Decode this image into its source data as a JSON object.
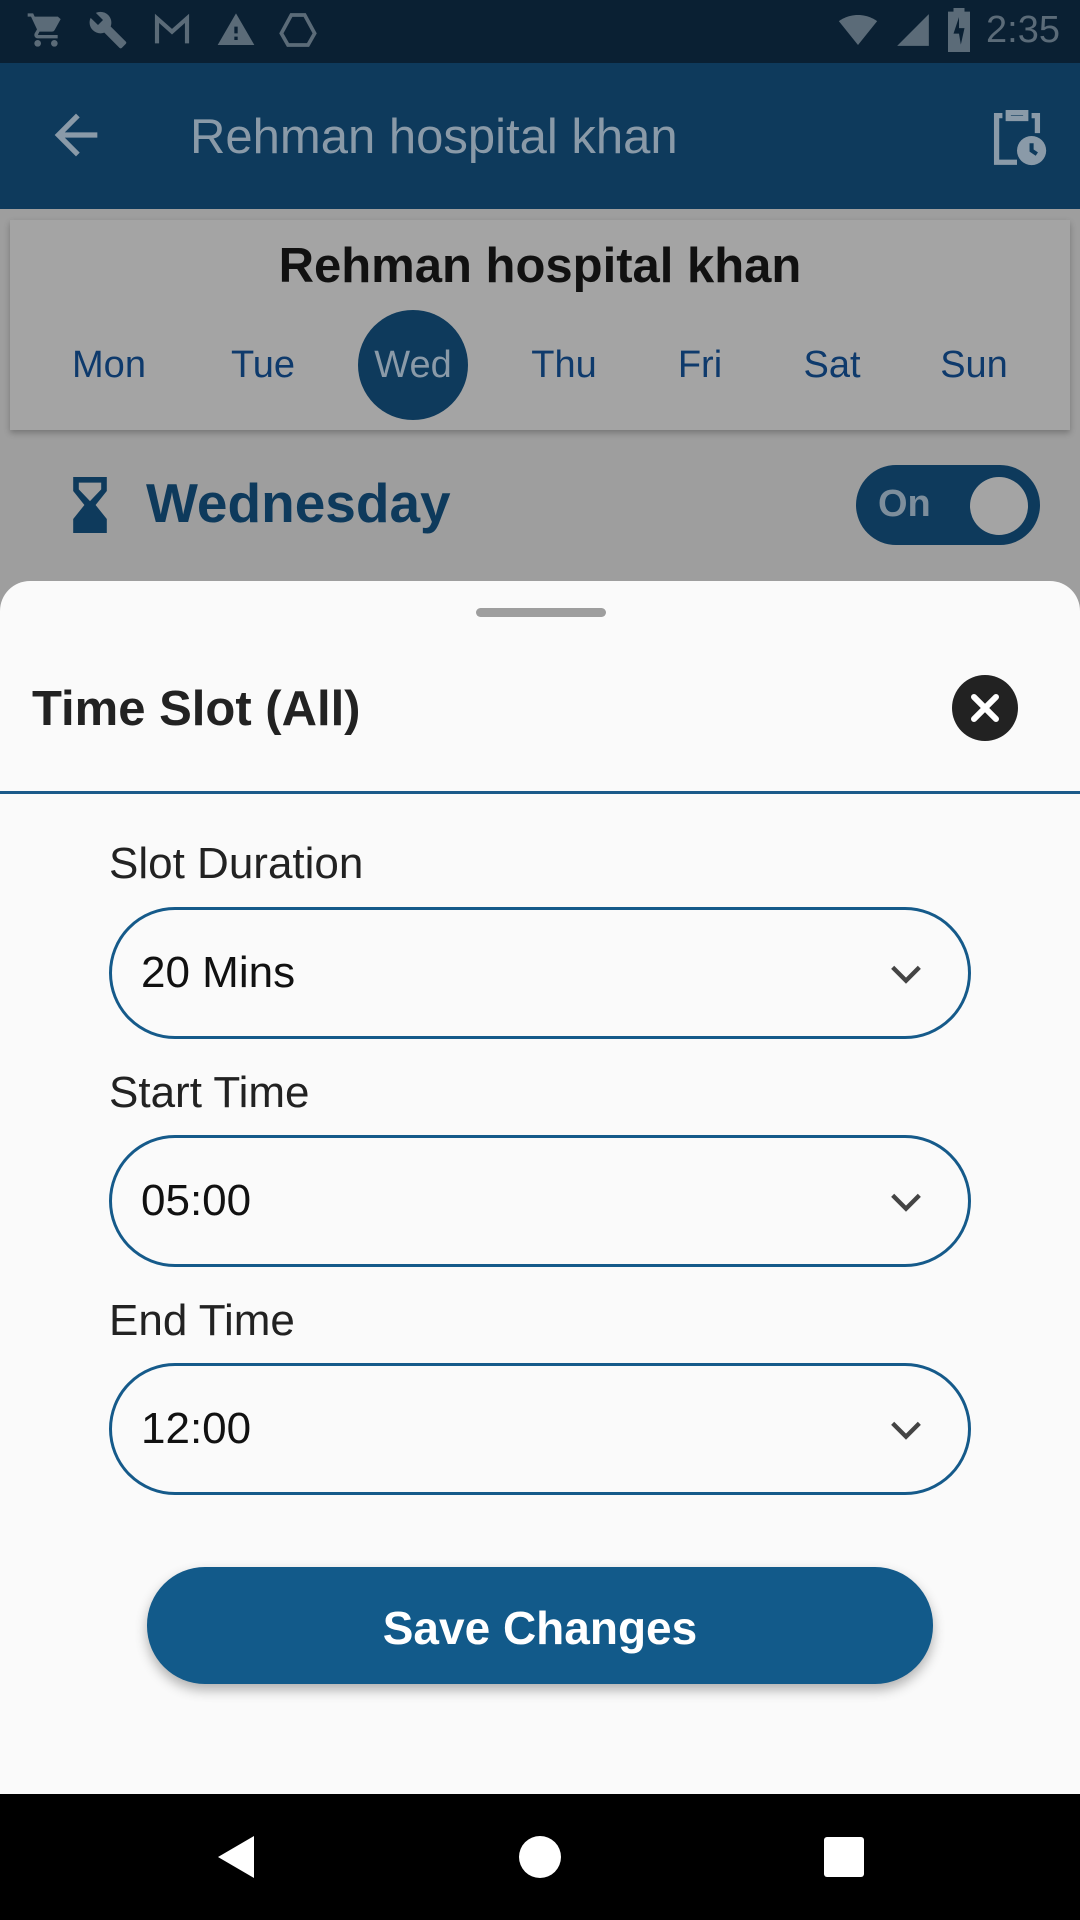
{
  "status_bar": {
    "time": "2:35",
    "icons": [
      "cart-icon",
      "wrench-icon",
      "gmail-icon",
      "warning-icon",
      "drive-icon",
      "wifi-icon",
      "signal-icon",
      "battery-icon"
    ]
  },
  "app_bar": {
    "title": "Rehman hospital khan",
    "back_icon": "arrow-back-icon",
    "action_icon": "clipboard-clock-icon"
  },
  "schedule_card": {
    "hospital_name": "Rehman hospital khan",
    "days": [
      {
        "label": "Mon",
        "selected": false
      },
      {
        "label": "Tue",
        "selected": false
      },
      {
        "label": "Wed",
        "selected": true
      },
      {
        "label": "Thu",
        "selected": false
      },
      {
        "label": "Fri",
        "selected": false
      },
      {
        "label": "Sat",
        "selected": false
      },
      {
        "label": "Sun",
        "selected": false
      }
    ]
  },
  "day_row": {
    "day_name": "Wednesday",
    "toggle_label": "On",
    "toggle_on": true
  },
  "sheet": {
    "title": "Time Slot (All)",
    "fields": [
      {
        "label": "Slot Duration",
        "value": "20 Mins"
      },
      {
        "label": "Start Time",
        "value": "05:00"
      },
      {
        "label": "End Time",
        "value": "12:00"
      }
    ],
    "save_label": "Save Changes"
  },
  "colors": {
    "primary": "#0e3a5c",
    "accent": "#125a8a",
    "sheet_bg": "#fafafa",
    "scrim": "#9e9e9e"
  }
}
